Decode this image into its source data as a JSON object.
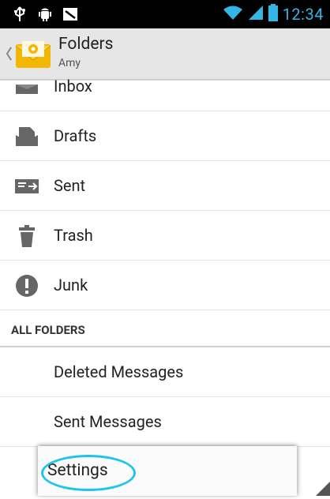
{
  "status_bar": {
    "time": "12:34",
    "left_icons": [
      "usb-icon",
      "android-debug-icon",
      "mail-notification-icon"
    ],
    "right_icons": [
      "wifi-icon",
      "signal-icon",
      "battery-icon"
    ],
    "accent": "#33b5e5"
  },
  "action_bar": {
    "title": "Folders",
    "subtitle": "Amy"
  },
  "folders": [
    {
      "label": "Inbox",
      "icon": "inbox-icon"
    },
    {
      "label": "Drafts",
      "icon": "drafts-icon"
    },
    {
      "label": "Sent",
      "icon": "sent-icon"
    },
    {
      "label": "Trash",
      "icon": "trash-icon"
    },
    {
      "label": "Junk",
      "icon": "junk-icon"
    }
  ],
  "all_folders": {
    "header": "ALL FOLDERS",
    "items": [
      "Deleted Messages",
      "Sent Messages"
    ]
  },
  "menu": {
    "item": "Settings",
    "highlight_color": "#1ec4ee"
  }
}
